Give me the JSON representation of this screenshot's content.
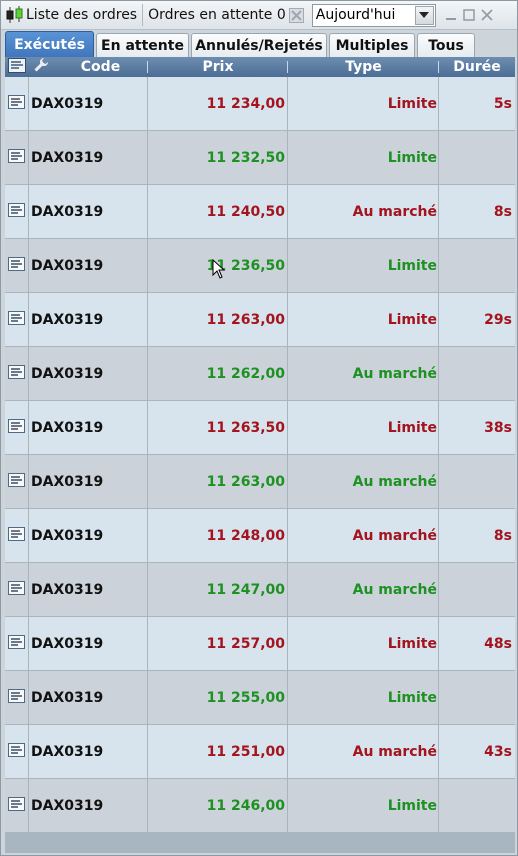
{
  "titlebar": {
    "title": "Liste des ordres",
    "pending_label": "Ordres en attente 0",
    "date_filter": "Aujourd'hui"
  },
  "tabs": [
    {
      "label": "Exécutés",
      "active": true
    },
    {
      "label": "En attente",
      "active": false
    },
    {
      "label": "Annulés/Rejetés",
      "active": false
    },
    {
      "label": "Multiples",
      "active": false
    },
    {
      "label": "Tous",
      "active": false
    }
  ],
  "columns": {
    "code": "Code",
    "prix": "Prix",
    "type": "Type",
    "duree": "Durée"
  },
  "colors": {
    "sell": "#a3141e",
    "buy": "#1d9121",
    "tab_active": "#4a84cb",
    "header": "#5a7ba0"
  },
  "rows": [
    {
      "code": "DAX0319",
      "prix": "11 234,00",
      "type": "Limite",
      "duree": "5s",
      "side": "sell"
    },
    {
      "code": "DAX0319",
      "prix": "11 232,50",
      "type": "Limite",
      "duree": "",
      "side": "buy"
    },
    {
      "code": "DAX0319",
      "prix": "11 240,50",
      "type": "Au marché",
      "duree": "8s",
      "side": "sell"
    },
    {
      "code": "DAX0319",
      "prix": "11 236,50",
      "type": "Limite",
      "duree": "",
      "side": "buy"
    },
    {
      "code": "DAX0319",
      "prix": "11 263,00",
      "type": "Limite",
      "duree": "29s",
      "side": "sell"
    },
    {
      "code": "DAX0319",
      "prix": "11 262,00",
      "type": "Au marché",
      "duree": "",
      "side": "buy"
    },
    {
      "code": "DAX0319",
      "prix": "11 263,50",
      "type": "Limite",
      "duree": "38s",
      "side": "sell"
    },
    {
      "code": "DAX0319",
      "prix": "11 263,00",
      "type": "Au marché",
      "duree": "",
      "side": "buy"
    },
    {
      "code": "DAX0319",
      "prix": "11 248,00",
      "type": "Au marché",
      "duree": "8s",
      "side": "sell"
    },
    {
      "code": "DAX0319",
      "prix": "11 247,00",
      "type": "Au marché",
      "duree": "",
      "side": "buy"
    },
    {
      "code": "DAX0319",
      "prix": "11 257,00",
      "type": "Limite",
      "duree": "48s",
      "side": "sell"
    },
    {
      "code": "DAX0319",
      "prix": "11 255,00",
      "type": "Limite",
      "duree": "",
      "side": "buy"
    },
    {
      "code": "DAX0319",
      "prix": "11 251,00",
      "type": "Au marché",
      "duree": "43s",
      "side": "sell"
    },
    {
      "code": "DAX0319",
      "prix": "11 246,00",
      "type": "Limite",
      "duree": "",
      "side": "buy"
    }
  ]
}
